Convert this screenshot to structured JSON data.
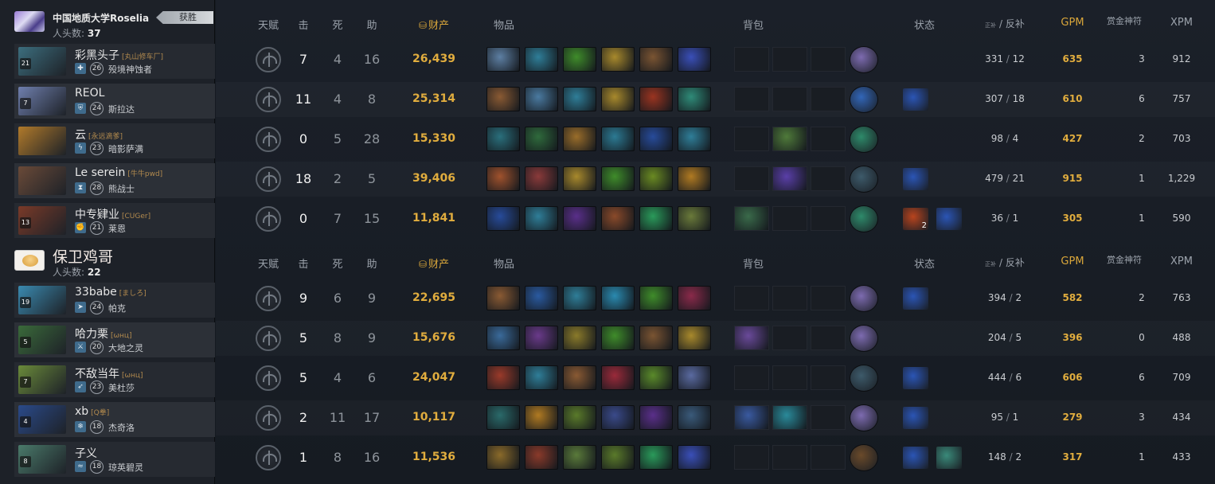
{
  "teams": [
    {
      "name": "中国地质大学Roselia",
      "kills_label": "人头数:",
      "kills": "37",
      "badge": "获胜",
      "players": [
        {
          "name": "彩黑头子",
          "tag": "[丸山修车厂]",
          "level": "26",
          "hero": "殁境神蚀者",
          "avatar_level": "21",
          "avatar_color": "#3c6e7e",
          "role_icon": "heal-icon",
          "kills": "7",
          "deaths": "4",
          "assists": "16",
          "net_worth": "26,439",
          "items": [
            "#5d7fa3",
            "#2f7e98",
            "#3f8c2a",
            "#a8892c",
            "#7a5432",
            "#3a4fb8"
          ],
          "backpack": [
            "",
            "",
            ""
          ],
          "neutral": "#7d6bb0",
          "buffs": [],
          "last_hits": "331",
          "denies": "12",
          "gpm": "635",
          "bounty": "3",
          "xpm": "912"
        },
        {
          "name": "REOL",
          "tag": "",
          "level": "24",
          "hero": "斯拉达",
          "avatar_level": "7",
          "avatar_color": "#6f7fae",
          "role_icon": "shield-icon",
          "kills": "11",
          "deaths": "4",
          "assists": "8",
          "net_worth": "25,314",
          "items": [
            "#8a5a33",
            "#4a7aa0",
            "#2f7e98",
            "#a8892c",
            "#9a3420",
            "#2f8b78"
          ],
          "backpack": [
            "",
            "",
            ""
          ],
          "neutral": "#3266b8",
          "buffs": [
            "#2b55b5"
          ],
          "last_hits": "307",
          "denies": "18",
          "gpm": "610",
          "bounty": "6",
          "xpm": "757"
        },
        {
          "name": "云",
          "tag": "[永远滴爹]",
          "level": "23",
          "hero": "暗影萨满",
          "avatar_level": "",
          "avatar_color": "#b17a2a",
          "role_icon": "lightning-icon",
          "kills": "0",
          "deaths": "5",
          "assists": "28",
          "net_worth": "15,330",
          "items": [
            "#2a6f7c",
            "#2f6a3c",
            "#9a6d2a",
            "#2c7a93",
            "#274b9a",
            "#2f7e98"
          ],
          "backpack": [
            "",
            "#4f7a3a",
            ""
          ],
          "neutral": "#2e8a6a",
          "buffs": [],
          "last_hits": "98",
          "denies": "4",
          "gpm": "427",
          "bounty": "2",
          "xpm": "703"
        },
        {
          "name": "Le serein",
          "tag": "[牛牛pwd]",
          "level": "28",
          "hero": "熊战士",
          "avatar_level": "",
          "avatar_color": "#6a4a38",
          "role_icon": "hourglass-icon",
          "kills": "18",
          "deaths": "2",
          "assists": "5",
          "net_worth": "39,406",
          "items": [
            "#a0522d",
            "#8a3a3a",
            "#a8892c",
            "#3f8c2a",
            "#6a8a22",
            "#b07a22"
          ],
          "backpack": [
            "",
            "#5a3fa8",
            ""
          ],
          "neutral": "#3d5a6a",
          "buffs": [
            "#2b55b5"
          ],
          "last_hits": "479",
          "denies": "21",
          "gpm": "915",
          "bounty": "1",
          "xpm": "1,229"
        },
        {
          "name": "中专肄业",
          "tag": "[CUGer]",
          "level": "21",
          "hero": "莱恩",
          "avatar_level": "13",
          "avatar_color": "#7a3a28",
          "role_icon": "fist-icon",
          "kills": "0",
          "deaths": "7",
          "assists": "15",
          "net_worth": "11,841",
          "items": [
            "#274b9a",
            "#2f7e98",
            "#5a2f8a",
            "#8a4a2a",
            "#2a9a5a",
            "#6a7a3a"
          ],
          "backpack": [
            "#3a6a4a",
            "",
            ""
          ],
          "neutral": "#2e8a6a",
          "buffs": [
            "#b8441e",
            "#2b55b5"
          ],
          "buff_stack": "2",
          "last_hits": "36",
          "denies": "1",
          "gpm": "305",
          "bounty": "1",
          "xpm": "590"
        }
      ]
    },
    {
      "name": "保卫鸡哥",
      "kills_label": "人头数:",
      "kills": "22",
      "badge": "",
      "players": [
        {
          "name": "33babe",
          "tag": "[ましろ]",
          "level": "24",
          "hero": "帕克",
          "avatar_level": "19",
          "avatar_color": "#3a8ab0",
          "role_icon": "run-icon",
          "kills": "9",
          "deaths": "6",
          "assists": "9",
          "net_worth": "22,695",
          "items": [
            "#8a5a33",
            "#2a5aa0",
            "#2f7e98",
            "#2a8ab0",
            "#3f8c2a",
            "#8a2a4a"
          ],
          "backpack": [
            "",
            "",
            ""
          ],
          "neutral": "#7d6bb0",
          "buffs": [
            "#2b55b5"
          ],
          "last_hits": "394",
          "denies": "2",
          "gpm": "582",
          "bounty": "2",
          "xpm": "763"
        },
        {
          "name": "哈力栗",
          "tag": "[ωнц]",
          "level": "20",
          "hero": "大地之灵",
          "avatar_level": "5",
          "avatar_color": "#3a6a3a",
          "role_icon": "sword-icon",
          "kills": "5",
          "deaths": "8",
          "assists": "9",
          "net_worth": "15,676",
          "items": [
            "#3a6a9a",
            "#6a3a8a",
            "#8a7a2a",
            "#3f8c2a",
            "#7a5432",
            "#a8892c"
          ],
          "backpack": [
            "#6a4a9a",
            "",
            ""
          ],
          "neutral": "#7d6bb0",
          "buffs": [],
          "last_hits": "204",
          "denies": "5",
          "gpm": "396",
          "bounty": "0",
          "xpm": "488"
        },
        {
          "name": "不敌当年",
          "tag": "[ωнц]",
          "level": "23",
          "hero": "美杜莎",
          "avatar_level": "7",
          "avatar_color": "#6a8a3a",
          "role_icon": "bow-icon",
          "kills": "5",
          "deaths": "4",
          "assists": "6",
          "net_worth": "24,047",
          "items": [
            "#9a3a2a",
            "#2f7e98",
            "#8a5a33",
            "#9a2a3a",
            "#5a8a2a",
            "#5a6aa0"
          ],
          "backpack": [
            "",
            "",
            ""
          ],
          "neutral": "#3d5a6a",
          "buffs": [
            "#2b55b5"
          ],
          "last_hits": "444",
          "denies": "6",
          "gpm": "606",
          "bounty": "6",
          "xpm": "709"
        },
        {
          "name": "xb",
          "tag": "[Q拳]",
          "level": "18",
          "hero": "杰奇洛",
          "avatar_level": "4",
          "avatar_color": "#2a4a8a",
          "role_icon": "snowflake-icon",
          "kills": "2",
          "deaths": "11",
          "assists": "17",
          "net_worth": "10,117",
          "items": [
            "#2a6a6a",
            "#b07a22",
            "#5a7a2a",
            "#3a4a8a",
            "#5a2f8a",
            "#3a5a7a"
          ],
          "backpack": [
            "#3a5aa0",
            "#2a8a9a",
            ""
          ],
          "neutral": "#7d6bb0",
          "buffs": [
            "#2b55b5"
          ],
          "last_hits": "95",
          "denies": "1",
          "gpm": "279",
          "bounty": "3",
          "xpm": "434"
        },
        {
          "name": "子义",
          "tag": "",
          "level": "18",
          "hero": "琼英碧灵",
          "avatar_level": "8",
          "avatar_color": "#4a7a6a",
          "role_icon": "wave-icon",
          "kills": "1",
          "deaths": "8",
          "assists": "16",
          "net_worth": "11,536",
          "items": [
            "#8a6a2a",
            "#8a3a2a",
            "#5a7a3a",
            "#5a7a2a",
            "#2a9a5a",
            "#3a4fb8"
          ],
          "backpack": [
            "",
            "",
            ""
          ],
          "neutral": "#6a4a2a",
          "buffs": [
            "#2b55b5",
            "#3a8a7a"
          ],
          "last_hits": "148",
          "denies": "2",
          "gpm": "317",
          "bounty": "1",
          "xpm": "433"
        }
      ]
    }
  ],
  "columns": {
    "talent": "天赋",
    "kills": "击",
    "deaths": "死",
    "assists": "助",
    "net_worth": "财产",
    "items": "物品",
    "backpack": "背包",
    "status": "状态",
    "last_hits_small": "正补",
    "slash": "/",
    "denies": "反补",
    "gpm": "GPM",
    "bounty": "赏金神符",
    "xpm": "XPM"
  },
  "colors": {
    "gold": "#e1ad3e",
    "bg": "#151a21",
    "panel": "#1d2128"
  }
}
